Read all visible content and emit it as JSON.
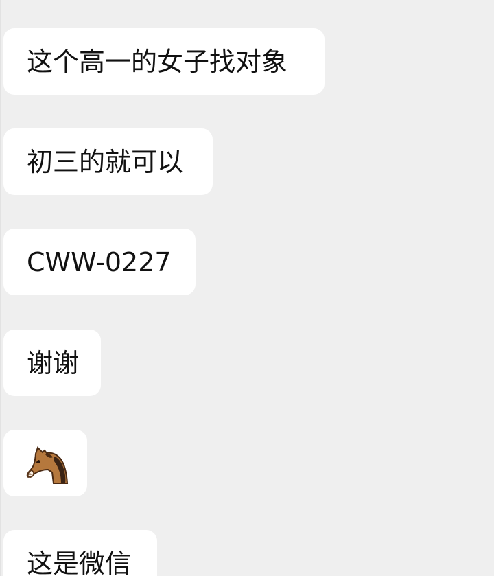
{
  "conversation": {
    "messages": [
      {
        "type": "text",
        "text": "这个高一的女子找对象"
      },
      {
        "type": "text",
        "text": "初三的就可以"
      },
      {
        "type": "text",
        "text": "CWW-0227"
      },
      {
        "type": "text",
        "text": "谢谢"
      },
      {
        "type": "emoji",
        "icon": "horse-face-icon"
      },
      {
        "type": "text",
        "text": "这是微信"
      }
    ]
  },
  "colors": {
    "background": "#efefef",
    "bubble": "#ffffff",
    "text": "#111111"
  }
}
